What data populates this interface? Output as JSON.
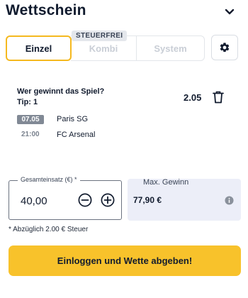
{
  "header": {
    "title": "Wettschein",
    "collapse_icon": "chevron-down-icon"
  },
  "tabs": [
    {
      "label": "Einzel",
      "active": true
    },
    {
      "label": "Kombi",
      "active": false
    },
    {
      "label": "System",
      "active": false
    }
  ],
  "kombi_badge": "STEUERFREI",
  "settings_icon": "gear-icon",
  "bet": {
    "question": "Wer gewinnt das Spiel?",
    "tip": "Tip: 1",
    "odds": "2.05",
    "date": "07.05",
    "time": "21:00",
    "home_team": "Paris SG",
    "away_team": "FC Arsenal"
  },
  "stake": {
    "label": "Gesamteinsatz (€) *",
    "value": "40,00"
  },
  "max_win": {
    "label": "Max. Gewinn",
    "value": "77,90 €"
  },
  "tax_note": "* Abzüglich 2.00 € Steuer",
  "cta_label": "Einloggen und Wette abgeben!",
  "colors": {
    "accent": "#f8c22b",
    "date_chip": "#818995",
    "win_box": "#eceef8"
  }
}
